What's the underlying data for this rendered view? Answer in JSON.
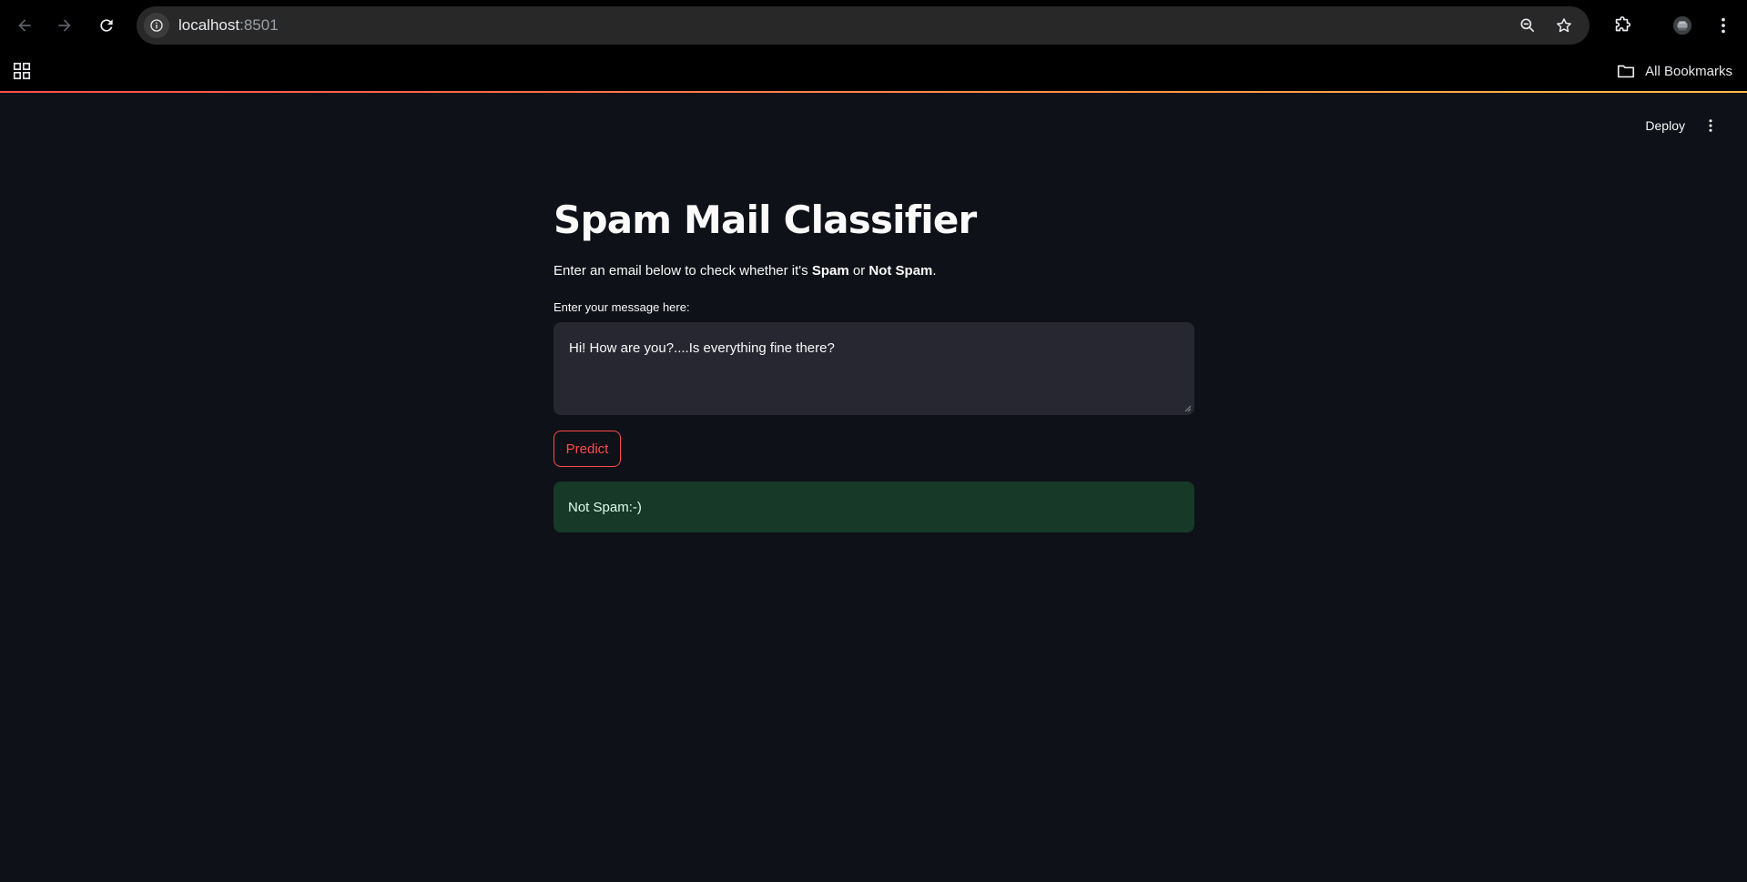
{
  "browser": {
    "url_host": "localhost",
    "url_port": ":8501",
    "bookmarks_label": "All Bookmarks"
  },
  "app": {
    "deploy_label": "Deploy",
    "title": "Spam Mail Classifier",
    "subtitle_prefix": "Enter an email below to check whether it's ",
    "subtitle_spam": "Spam",
    "subtitle_or": " or ",
    "subtitle_not_spam": "Not Spam",
    "subtitle_suffix": ".",
    "input_label": "Enter your message here:",
    "input_value": "Hi! How are you?....Is everything fine there?",
    "predict_label": "Predict",
    "result_text": "Not Spam:-)"
  },
  "colors": {
    "background": "#0e1117",
    "accent": "#ff4b4b",
    "success_bg": "#173928",
    "success_text": "#dffde9"
  }
}
